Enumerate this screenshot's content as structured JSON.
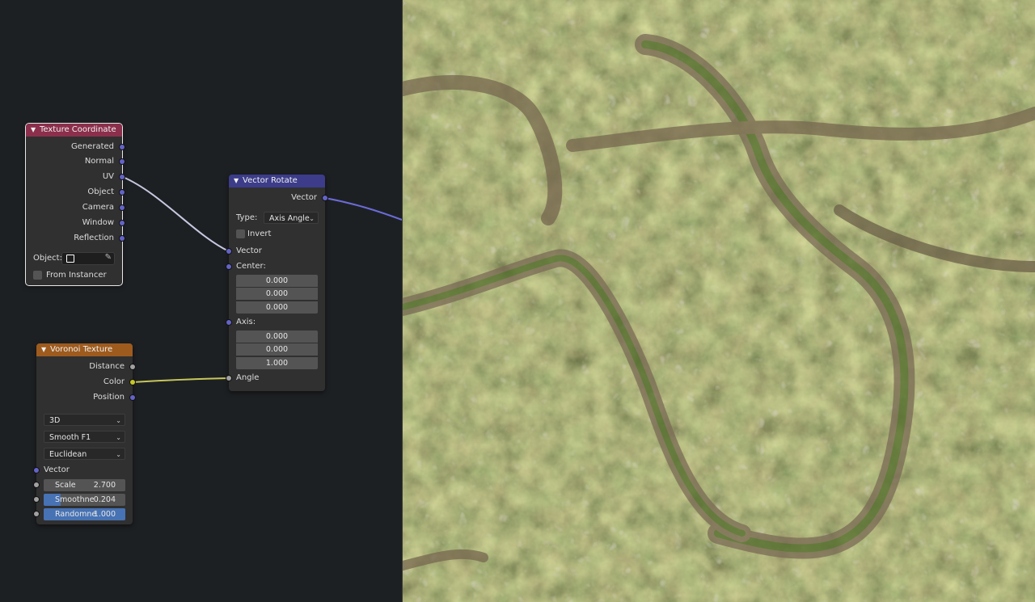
{
  "texture_coordinate": {
    "title": "Texture Coordinate",
    "outputs": [
      "Generated",
      "Normal",
      "UV",
      "Object",
      "Camera",
      "Window",
      "Reflection"
    ],
    "object_label": "Object:",
    "from_instancer": "From Instancer",
    "header_color": "#8b2f4c"
  },
  "vector_rotate": {
    "title": "Vector Rotate",
    "output": "Vector",
    "type_label": "Type:",
    "type_value": "Axis Angle",
    "invert_label": "Invert",
    "vector_input": "Vector",
    "center_label": "Center:",
    "center": [
      "0.000",
      "0.000",
      "0.000"
    ],
    "axis_label": "Axis:",
    "axis": [
      "0.000",
      "0.000",
      "1.000"
    ],
    "angle_label": "Angle",
    "header_color": "#3c3c8a"
  },
  "voronoi": {
    "title": "Voronoi Texture",
    "outputs": [
      "Distance",
      "Color",
      "Position"
    ],
    "dimension": "3D",
    "feature": "Smooth F1",
    "metric": "Euclidean",
    "vector_input": "Vector",
    "scale_label": "Scale",
    "scale_value": "2.700",
    "smooth_label": "Smoothne",
    "smooth_value": "0.204",
    "smooth_fill": 0.204,
    "random_label": "Randomne",
    "random_value": "1.000",
    "random_fill": 1.0,
    "header_color": "#9e5b1e"
  },
  "viewport": {
    "content": "rendered-terrain-texture"
  }
}
